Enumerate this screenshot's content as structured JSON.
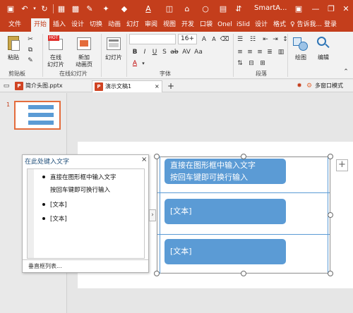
{
  "title_bar": {
    "doc_title": "SmartA...",
    "colors": {
      "accent": "#c43e1c",
      "ribbon_bg": "#f2f2f2",
      "smartart_blue": "#5b9bd5"
    }
  },
  "tabs": [
    "文件",
    "开始",
    "插入",
    "设计",
    "切换",
    "动画",
    "幻灯",
    "审阅",
    "视图",
    "开发",
    "口袋",
    "Onel",
    "iSlid",
    "设计",
    "格式"
  ],
  "tab_help": "♀ 告诉我...",
  "tab_login": "登录",
  "ribbon": {
    "paste": "粘贴",
    "online_slides": [
      "在线",
      "幻灯片"
    ],
    "new_slide": [
      "新加",
      "动画页"
    ],
    "slides_btn": "幻灯片",
    "font_size": "16+",
    "drawing": "绘图",
    "editing": "编辑",
    "groups": [
      "剪贴板",
      "在线幻灯片",
      "字体",
      "段落"
    ]
  },
  "doc_tabs": [
    "简介头图.pptx",
    "演示文稿1"
  ],
  "window_ctrl": "多窗口模式",
  "thumbnail": {
    "slide_number": "1"
  },
  "text_pane": {
    "title": "在此处键入文字",
    "close": "×",
    "items": [
      "直接在图形框中输入文字",
      "按回车键即可换行输入",
      "[文本]",
      "[文本]"
    ],
    "footer": "垂直框列表..."
  },
  "smartart": {
    "shapes": [
      [
        "直接在图形框中输入文字",
        "按回车键即可换行输入"
      ],
      [
        "[文本]"
      ],
      [
        "[文本]"
      ]
    ]
  }
}
